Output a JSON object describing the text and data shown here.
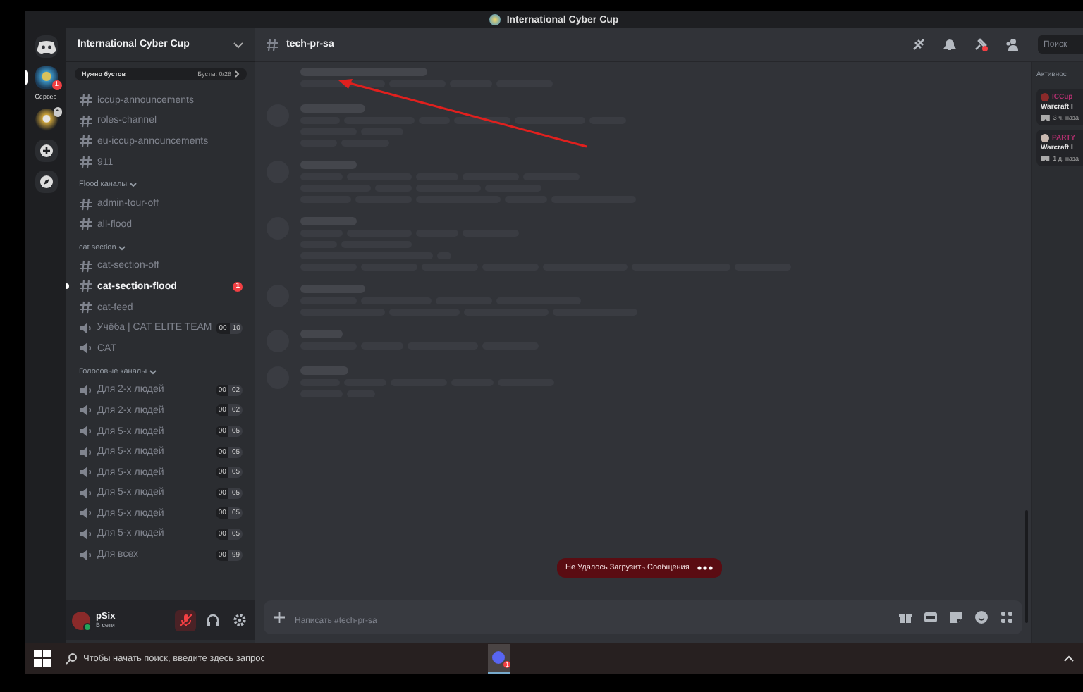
{
  "window": {
    "title": "International Cyber Cup"
  },
  "servers": [
    {
      "kind": "home",
      "selected": false
    },
    {
      "kind": "server",
      "selected": true,
      "badge": "1",
      "label": "Сервер"
    },
    {
      "kind": "server",
      "selected": false,
      "badge": "•"
    },
    {
      "kind": "add"
    },
    {
      "kind": "explore"
    }
  ],
  "sidebar": {
    "server_name": "International Cyber Cup",
    "boost": {
      "label": "Нужно бустов",
      "count": "Бусты: 0/28"
    },
    "groups": [
      {
        "channels": [
          {
            "kind": "text",
            "name": "iccup-announcements",
            "selected": false,
            "unread": false
          },
          {
            "kind": "text",
            "name": "roles-channel",
            "selected": false,
            "unread": false
          },
          {
            "kind": "text",
            "name": "eu-iccup-announcements",
            "selected": false,
            "unread": false
          },
          {
            "kind": "text",
            "name": "911",
            "selected": false,
            "unread": false
          }
        ]
      },
      {
        "name": "Flood каналы",
        "channels": [
          {
            "kind": "text",
            "name": "admin-tour-off",
            "selected": false,
            "unread": false
          },
          {
            "kind": "text",
            "name": "all-flood",
            "selected": false,
            "unread": false
          }
        ]
      },
      {
        "name": "cat section",
        "channels": [
          {
            "kind": "text",
            "name": "cat-section-off",
            "selected": false,
            "unread": false
          },
          {
            "kind": "text",
            "name": "cat-section-flood",
            "selected": false,
            "unread": true,
            "badge": "1"
          },
          {
            "kind": "text",
            "name": "cat-feed",
            "selected": false,
            "unread": false
          },
          {
            "kind": "voice",
            "name": "Учёба | CAT ELITE TEAM",
            "selected": false,
            "unread": false,
            "users": "00",
            "limit": "10"
          },
          {
            "kind": "voice",
            "name": "CAT",
            "selected": false,
            "unread": false
          }
        ]
      },
      {
        "name": "Голосовые каналы",
        "channels": [
          {
            "kind": "voice",
            "name": "Для 2-х людей",
            "selected": false,
            "unread": false,
            "users": "00",
            "limit": "02"
          },
          {
            "kind": "voice",
            "name": "Для 2-х людей",
            "selected": false,
            "unread": false,
            "users": "00",
            "limit": "02"
          },
          {
            "kind": "voice",
            "name": "Для 5-х людей",
            "selected": false,
            "unread": false,
            "users": "00",
            "limit": "05"
          },
          {
            "kind": "voice",
            "name": "Для 5-х людей",
            "selected": false,
            "unread": false,
            "users": "00",
            "limit": "05"
          },
          {
            "kind": "voice",
            "name": "Для 5-х людей",
            "selected": false,
            "unread": false,
            "users": "00",
            "limit": "05"
          },
          {
            "kind": "voice",
            "name": "Для 5-х людей",
            "selected": false,
            "unread": false,
            "users": "00",
            "limit": "05"
          },
          {
            "kind": "voice",
            "name": "Для 5-х людей",
            "selected": false,
            "unread": false,
            "users": "00",
            "limit": "05"
          },
          {
            "kind": "voice",
            "name": "Для 5-х людей",
            "selected": false,
            "unread": false,
            "users": "00",
            "limit": "05"
          },
          {
            "kind": "voice",
            "name": "Для всех",
            "selected": false,
            "unread": false,
            "users": "00",
            "limit": "99"
          }
        ]
      }
    ]
  },
  "user": {
    "name": "pSix",
    "status": "В сети",
    "muted": true
  },
  "channel": {
    "name": "tech-pr-sa"
  },
  "search": {
    "placeholder": "Поиск"
  },
  "error_toast": {
    "text": "Не Удалось Загрузить Сообщения"
  },
  "composer": {
    "placeholder": "Написать #tech-pr-sa"
  },
  "activity": {
    "title": "Активнос",
    "items": [
      {
        "name": "ICCup",
        "game": "Warcraft I",
        "time": "3 ч. наза"
      },
      {
        "name": "PARTY",
        "game": "Warcraft I",
        "time": "1 д. наза"
      }
    ]
  },
  "taskbar": {
    "search_placeholder": "Чтобы начать поиск, введите здесь запрос",
    "app_badge": "1"
  }
}
